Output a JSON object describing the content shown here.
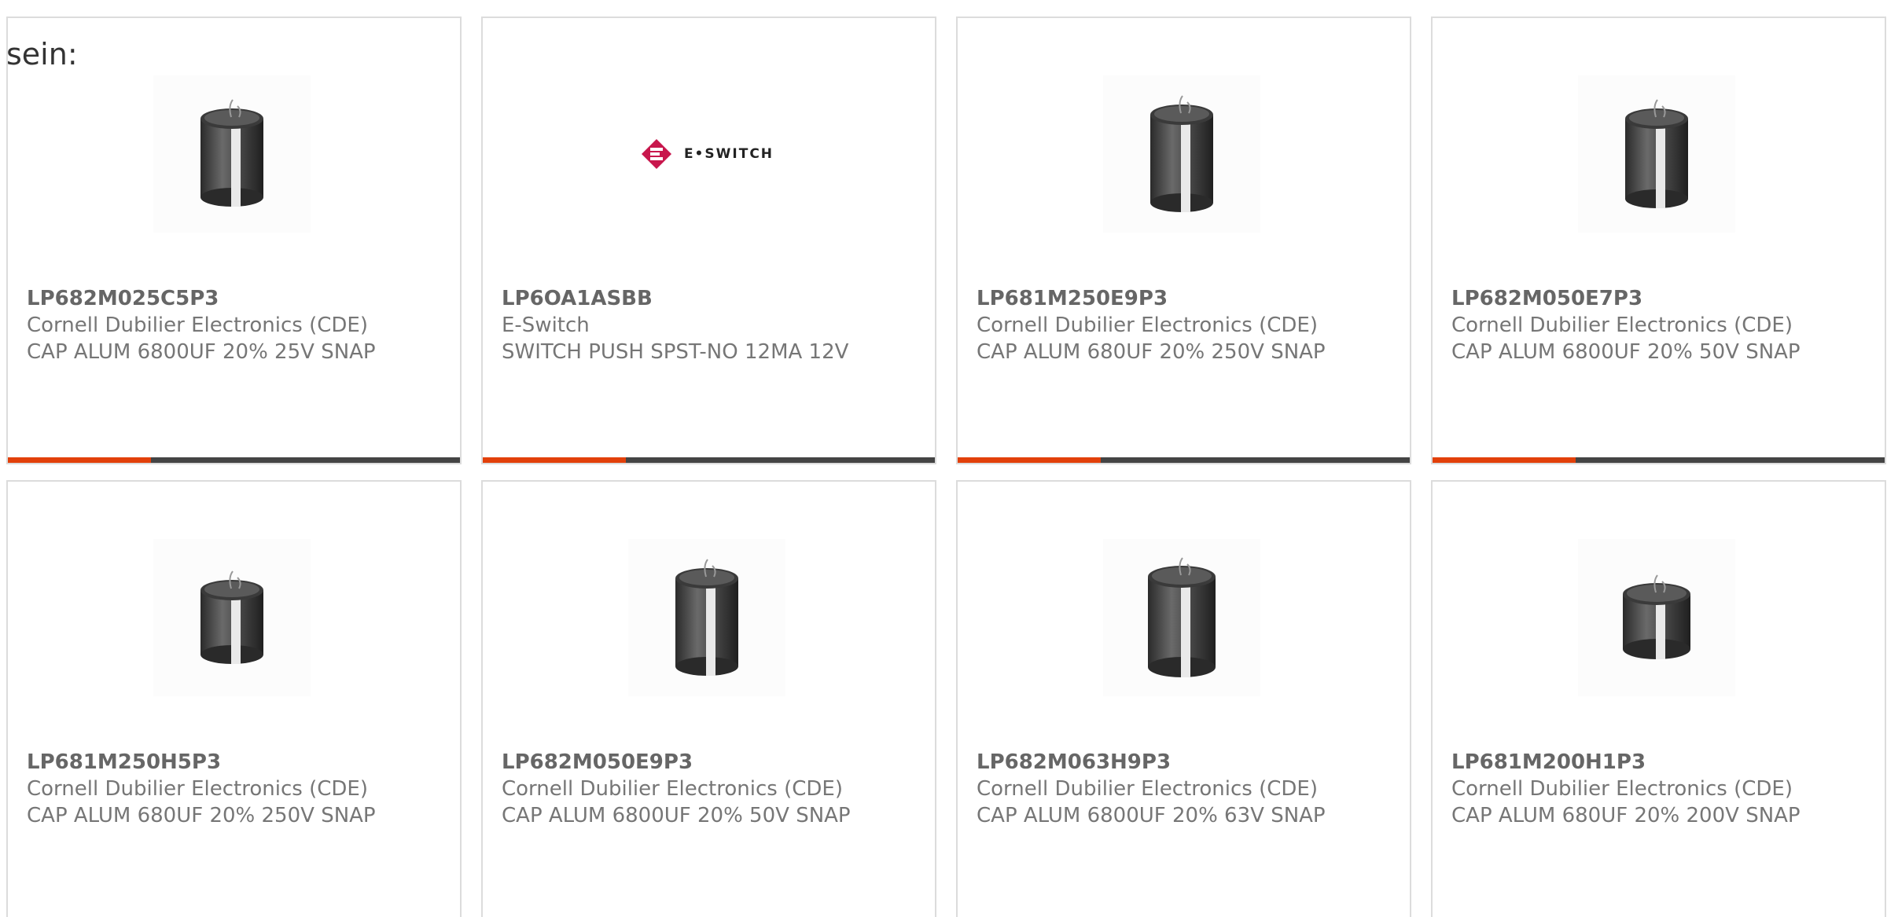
{
  "intro": {
    "text": "sein:"
  },
  "colors": {
    "accent": "#e2400a",
    "bar": "#444444",
    "border": "#dcdcdc",
    "text": "#767676",
    "logo_red": "#c8174d"
  },
  "products": [
    {
      "part_number": "LP682M025C5P3",
      "manufacturer": "Cornell Dubilier Electronics (CDE)",
      "description": "CAP ALUM 6800UF 20% 25V SNAP",
      "image": "capacitor-icon"
    },
    {
      "part_number": "LP6OA1ASBB",
      "manufacturer": "E-Switch",
      "description": "SWITCH PUSH SPST-NO 12MA 12V",
      "image": "eswitch-logo",
      "logo_text": "E•SWITCH"
    },
    {
      "part_number": "LP681M250E9P3",
      "manufacturer": "Cornell Dubilier Electronics (CDE)",
      "description": "CAP ALUM 680UF 20% 250V SNAP",
      "image": "capacitor-icon"
    },
    {
      "part_number": "LP682M050E7P3",
      "manufacturer": "Cornell Dubilier Electronics (CDE)",
      "description": "CAP ALUM 6800UF 20% 50V SNAP",
      "image": "capacitor-icon"
    },
    {
      "part_number": "LP681M250H5P3",
      "manufacturer": "Cornell Dubilier Electronics (CDE)",
      "description": "CAP ALUM 680UF 20% 250V SNAP",
      "image": "capacitor-icon"
    },
    {
      "part_number": "LP682M050E9P3",
      "manufacturer": "Cornell Dubilier Electronics (CDE)",
      "description": "CAP ALUM 6800UF 20% 50V SNAP",
      "image": "capacitor-icon"
    },
    {
      "part_number": "LP682M063H9P3",
      "manufacturer": "Cornell Dubilier Electronics (CDE)",
      "description": "CAP ALUM 6800UF 20% 63V SNAP",
      "image": "capacitor-icon"
    },
    {
      "part_number": "LP681M200H1P3",
      "manufacturer": "Cornell Dubilier Electronics (CDE)",
      "description": "CAP ALUM 680UF 20% 200V SNAP",
      "image": "capacitor-icon"
    }
  ]
}
